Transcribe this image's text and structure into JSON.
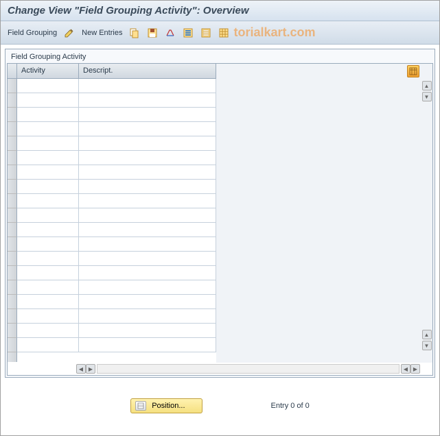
{
  "title": "Change View \"Field Grouping Activity\": Overview",
  "toolbar": {
    "field_grouping_label": "Field Grouping",
    "new_entries_label": "New Entries"
  },
  "watermark": "torialkart.com",
  "panel": {
    "title": "Field Grouping Activity"
  },
  "columns": {
    "activity": "Activity",
    "descript": "Descript."
  },
  "rows": [
    {
      "activity": "",
      "descript": ""
    },
    {
      "activity": "",
      "descript": ""
    },
    {
      "activity": "",
      "descript": ""
    },
    {
      "activity": "",
      "descript": ""
    },
    {
      "activity": "",
      "descript": ""
    },
    {
      "activity": "",
      "descript": ""
    },
    {
      "activity": "",
      "descript": ""
    },
    {
      "activity": "",
      "descript": ""
    },
    {
      "activity": "",
      "descript": ""
    },
    {
      "activity": "",
      "descript": ""
    },
    {
      "activity": "",
      "descript": ""
    },
    {
      "activity": "",
      "descript": ""
    },
    {
      "activity": "",
      "descript": ""
    },
    {
      "activity": "",
      "descript": ""
    },
    {
      "activity": "",
      "descript": ""
    },
    {
      "activity": "",
      "descript": ""
    },
    {
      "activity": "",
      "descript": ""
    },
    {
      "activity": "",
      "descript": ""
    },
    {
      "activity": "",
      "descript": ""
    }
  ],
  "footer": {
    "position_label": "Position...",
    "entry_label": "Entry 0 of 0"
  },
  "icons": {
    "edit": "edit-icon",
    "copy": "copy-icon",
    "save": "save-icon",
    "revise": "revise-icon",
    "select": "select-icon",
    "deselect": "deselect-icon",
    "config": "config-icon"
  }
}
